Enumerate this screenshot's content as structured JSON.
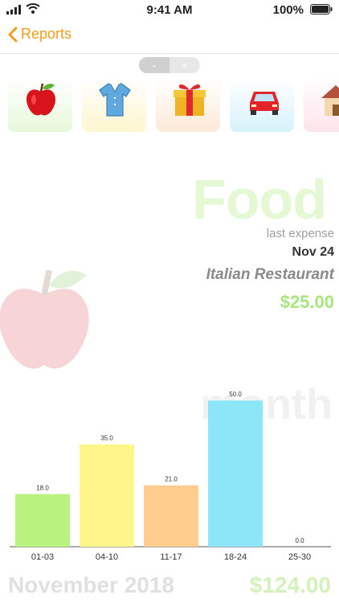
{
  "status": {
    "time": "9:41 AM",
    "battery": "100%"
  },
  "nav": {
    "back_label": "Reports"
  },
  "stepper": {
    "minus": "-",
    "plus": "+"
  },
  "categories": [
    {
      "name": "apple-icon",
      "tint": "#e7f8da"
    },
    {
      "name": "shirt-icon",
      "tint": "#fdf6cf"
    },
    {
      "name": "gift-icon",
      "tint": "#fde9d7"
    },
    {
      "name": "car-icon",
      "tint": "#d6f2fb"
    },
    {
      "name": "house-icon",
      "tint": "#fde3ea"
    }
  ],
  "detail": {
    "title": "Food",
    "last_label": "last expense",
    "date": "Nov 24",
    "merchant": "Italian Restaurant",
    "amount": "$25.00"
  },
  "watermark": "month",
  "chart_data": {
    "type": "bar",
    "categories": [
      "01-03",
      "04-10",
      "11-17",
      "18-24",
      "25-30"
    ],
    "values": [
      18.0,
      35.0,
      21.0,
      50.0,
      0.0
    ],
    "value_labels": [
      "18.0",
      "35.0",
      "21.0",
      "50.0",
      "0.0"
    ],
    "colors": [
      "#b8f37f",
      "#fff68b",
      "#ffcd8d",
      "#8de6f7",
      "#cccccc"
    ],
    "ylim": [
      0,
      55
    ]
  },
  "footer": {
    "month": "November 2018",
    "total": "$124.00"
  }
}
